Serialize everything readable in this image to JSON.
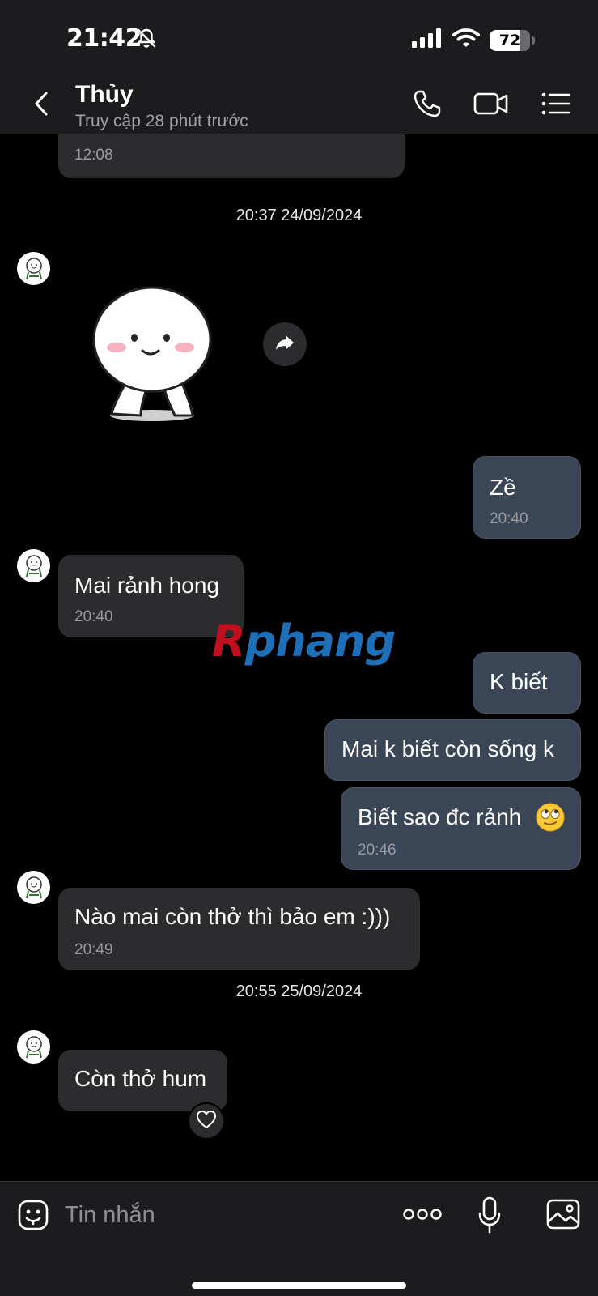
{
  "status_bar": {
    "time": "21:42",
    "battery": "72",
    "icons": [
      "bell-slash-icon",
      "cellular-signal-icon",
      "wifi-icon",
      "battery-icon"
    ]
  },
  "header": {
    "contact_name": "Thủy",
    "contact_status": "Truy cập 28 phút trước",
    "icons": [
      "chevron-left-icon",
      "phone-icon",
      "video-camera-icon",
      "list-menu-icon"
    ]
  },
  "conversation": {
    "partial_top_message": {
      "time": "12:08"
    },
    "date_separators": [
      "20:37 24/09/2024",
      "20:55 25/09/2024"
    ],
    "messages": [
      {
        "direction": "incoming",
        "type": "sticker",
        "sticker_name": "white-blob-character-sticker"
      },
      {
        "direction": "outgoing",
        "text": "Zề",
        "time": "20:40"
      },
      {
        "direction": "incoming",
        "text": "Mai rảnh hong",
        "time": "20:40"
      },
      {
        "direction": "outgoing",
        "text": "K biết"
      },
      {
        "direction": "outgoing",
        "text": "Mai k biết còn sống k"
      },
      {
        "direction": "outgoing",
        "text": "Biết sao đc rảnh",
        "emoji": "🙄",
        "time": "20:46"
      },
      {
        "direction": "incoming",
        "text": "Nào mai còn thở thì bảo em :)))",
        "time": "20:49"
      },
      {
        "direction": "incoming",
        "text": "Còn thở hum",
        "reaction": "heart-icon"
      }
    ]
  },
  "watermark": {
    "first": "R",
    "rest": "phang"
  },
  "input_bar": {
    "placeholder": "Tin nhắn",
    "icons": [
      "emoji-face-icon",
      "more-dots-icon",
      "microphone-icon",
      "image-gallery-icon"
    ]
  },
  "colors": {
    "background": "#000000",
    "bar_background": "#1c1c1e",
    "incoming_bubble": "#2c2c2e",
    "outgoing_bubble": "#3a4556",
    "watermark_red": "#c01020",
    "watermark_blue": "#1f6fb8"
  }
}
